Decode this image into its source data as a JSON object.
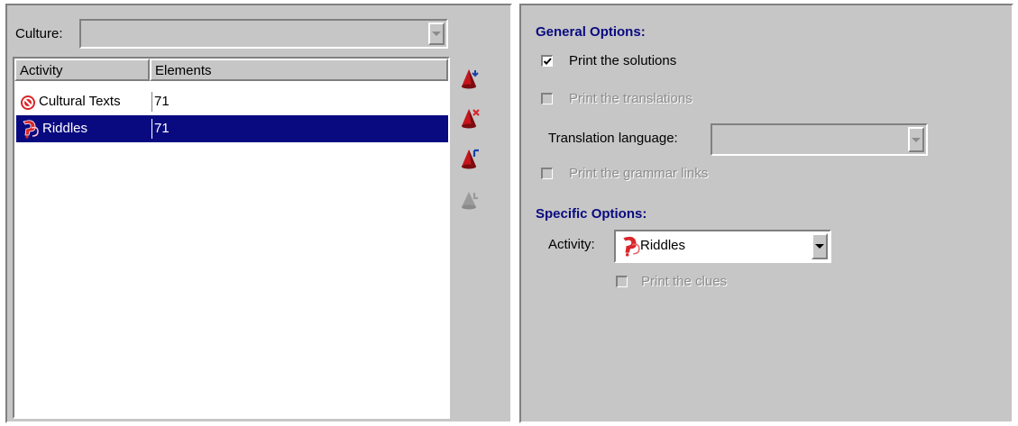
{
  "left": {
    "culture_label": "Culture:",
    "culture_value": "",
    "columns": [
      "Activity",
      "Elements"
    ],
    "rows": [
      {
        "activity": "Cultural Texts",
        "elements": "71",
        "icon": "cultural-texts-icon",
        "selected": false
      },
      {
        "activity": "Riddles",
        "elements": "71",
        "icon": "riddles-icon",
        "selected": true
      }
    ],
    "side_icons": [
      "add-activity-icon",
      "remove-activity-icon",
      "edit-activity-icon",
      "disabled-activity-icon"
    ]
  },
  "right": {
    "general_title": "General Options:",
    "print_solutions": {
      "label": "Print the solutions",
      "checked": true,
      "enabled": true
    },
    "print_translations": {
      "label": "Print the translations",
      "checked": false,
      "enabled": false
    },
    "translation_language_label": "Translation language:",
    "translation_language_value": "",
    "print_grammar": {
      "label": "Print the grammar links",
      "checked": false,
      "enabled": false
    },
    "specific_title": "Specific Options:",
    "activity_label": "Activity:",
    "activity_value": "Riddles",
    "print_clues": {
      "label": "Print the clues",
      "checked": false,
      "enabled": false
    }
  },
  "colors": {
    "panel": "#c6c6c6",
    "selection": "#0a0a80",
    "title": "#0a0a80",
    "disabled": "#8c8c8c"
  }
}
